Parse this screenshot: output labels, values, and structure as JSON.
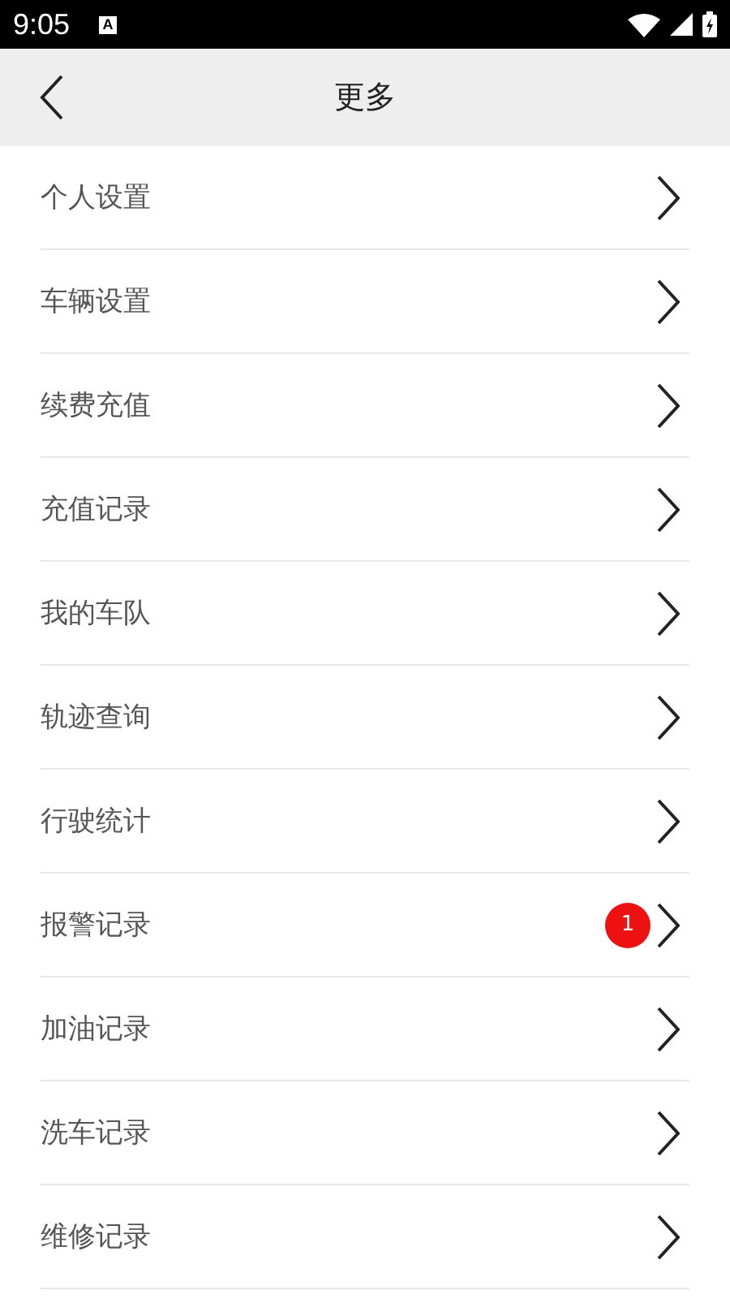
{
  "status_bar": {
    "time": "9:05",
    "notification": "A"
  },
  "header": {
    "title": "更多"
  },
  "items": [
    {
      "label": "个人设置"
    },
    {
      "label": "车辆设置"
    },
    {
      "label": "续费充值"
    },
    {
      "label": "充值记录"
    },
    {
      "label": "我的车队"
    },
    {
      "label": "轨迹查询"
    },
    {
      "label": "行驶统计"
    },
    {
      "label": "报警记录",
      "badge": "1"
    },
    {
      "label": "加油记录"
    },
    {
      "label": "洗车记录"
    },
    {
      "label": "维修记录"
    }
  ]
}
